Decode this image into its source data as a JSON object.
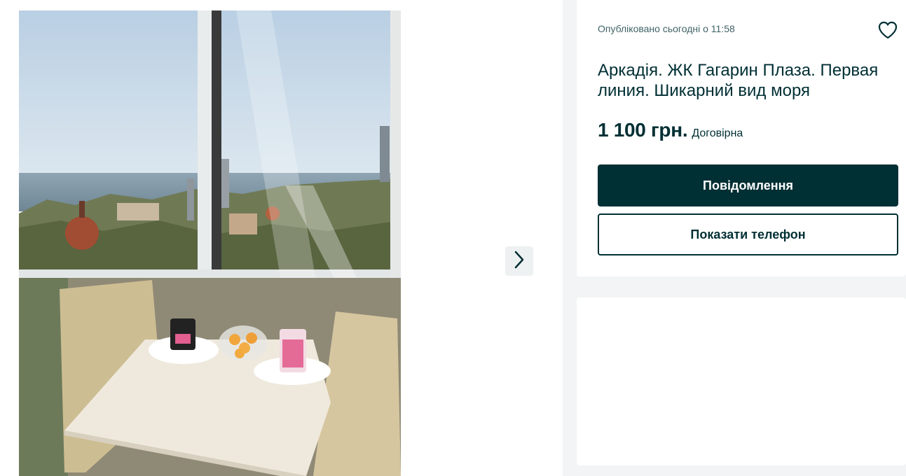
{
  "listing": {
    "posted": "Опубліковано сьогодні о 11:58",
    "title": "Аркадія. ЖК Гагарин Плаза. Первая линия. Шикарний вид моря",
    "price": "1 100 грн.",
    "negotiable": "Договірна"
  },
  "actions": {
    "message_label": "Повідомлення",
    "phone_label": "Показати телефон"
  },
  "icons": {
    "favorite": "heart-icon",
    "next": "chevron-right-icon"
  },
  "colors": {
    "primary": "#002f34",
    "page_bg": "#f2f4f5",
    "muted_text": "#406367"
  }
}
